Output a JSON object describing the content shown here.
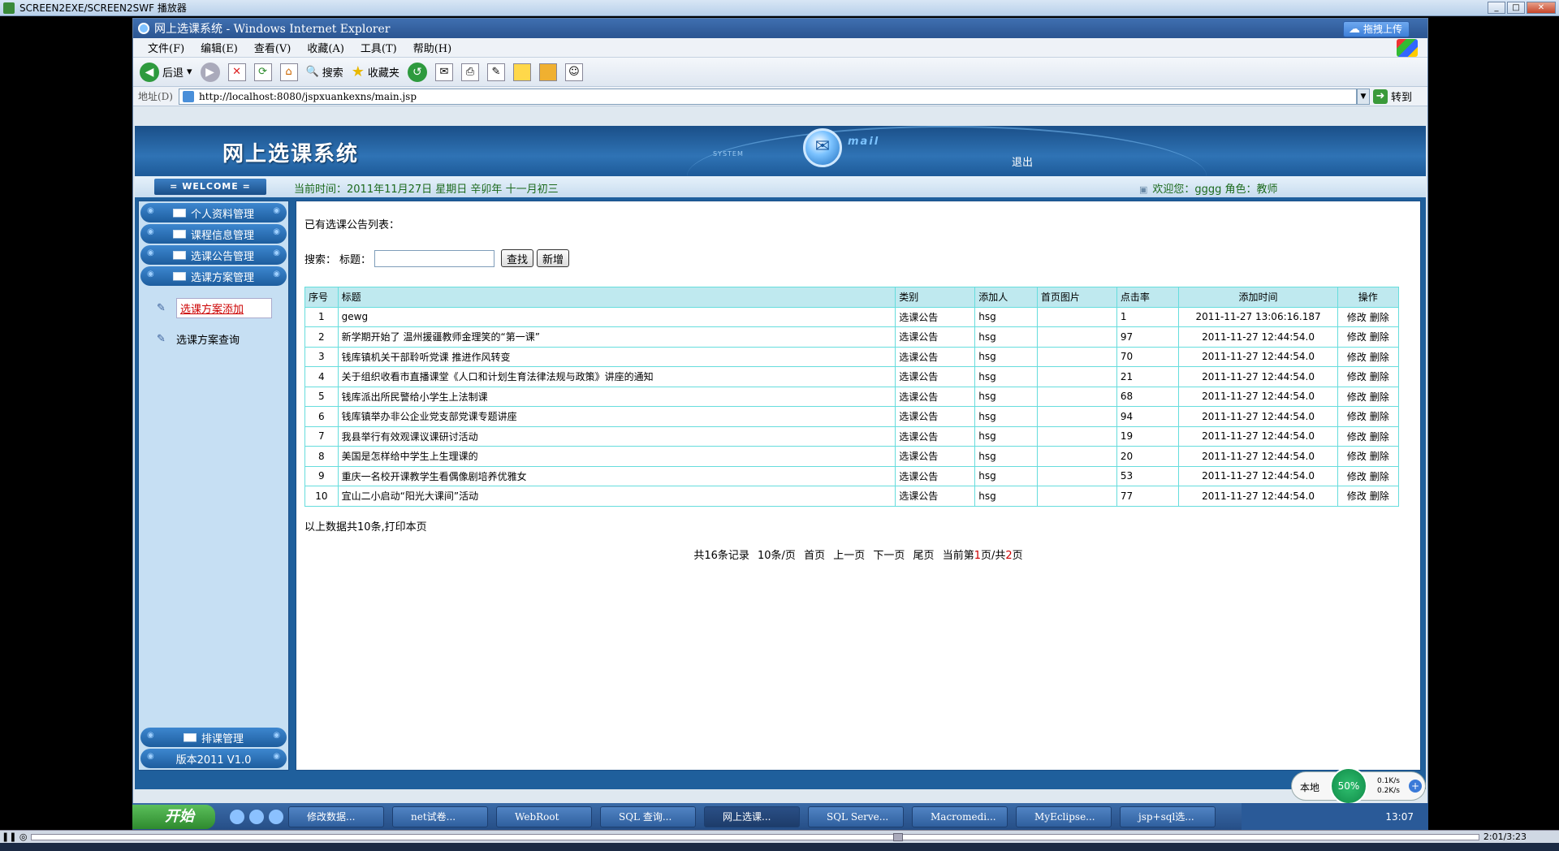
{
  "player": {
    "title": "SCREEN2EXE/SCREEN2SWF 播放器",
    "time": "2:01/3:23"
  },
  "ie": {
    "title": "网上选课系统 - Windows Internet Explorer",
    "baidu_btn": "拖拽上传",
    "menus": [
      "文件(F)",
      "编辑(E)",
      "查看(V)",
      "收藏(A)",
      "工具(T)",
      "帮助(H)"
    ],
    "toolbar": {
      "back": "后退",
      "search": "搜索",
      "favorites": "收藏夹"
    },
    "address_label": "地址(D)",
    "url": "http://localhost:8080/jspxuankexns/main.jsp",
    "go": "转到"
  },
  "header": {
    "system_title": "网上选课系统",
    "system_tag": "SYSTEM",
    "mail_text": "mail",
    "logout": "退出",
    "welcome": "= WELCOME =",
    "current_time": "当前时间：2011年11月27日 星期日 辛卯年 十一月初三",
    "user_info": "欢迎您：gggg 角色：教师"
  },
  "nav": {
    "items": [
      "个人资料管理",
      "课程信息管理",
      "选课公告管理",
      "选课方案管理"
    ],
    "sub_items": [
      "选课方案添加",
      "选课方案查询"
    ],
    "bottom_items": [
      "排课管理",
      "版本2011 V1.0"
    ]
  },
  "main": {
    "heading": "已有选课公告列表：",
    "search_label": "搜索：",
    "title_label": "标题：",
    "search_value": "",
    "search_btn": "查找",
    "add_btn": "新增",
    "columns": [
      "序号",
      "标题",
      "类别",
      "添加人",
      "首页图片",
      "点击率",
      "添加时间",
      "操作"
    ],
    "rows": [
      {
        "no": "1",
        "title": "gewg",
        "category": "选课公告",
        "author": "hsg",
        "image": "",
        "clicks": "1",
        "time": "2011-11-27 13:06:16.187"
      },
      {
        "no": "2",
        "title": "新学期开始了 温州援疆教师金理笑的“第一课”",
        "category": "选课公告",
        "author": "hsg",
        "image": "",
        "clicks": "97",
        "time": "2011-11-27 12:44:54.0"
      },
      {
        "no": "3",
        "title": "钱库镇机关干部聆听党课 推进作风转变",
        "category": "选课公告",
        "author": "hsg",
        "image": "",
        "clicks": "70",
        "time": "2011-11-27 12:44:54.0"
      },
      {
        "no": "4",
        "title": "关于组织收看市直播课堂《人口和计划生育法律法规与政策》讲座的通知",
        "category": "选课公告",
        "author": "hsg",
        "image": "",
        "clicks": "21",
        "time": "2011-11-27 12:44:54.0"
      },
      {
        "no": "5",
        "title": "钱库派出所民警给小学生上法制课",
        "category": "选课公告",
        "author": "hsg",
        "image": "",
        "clicks": "68",
        "time": "2011-11-27 12:44:54.0"
      },
      {
        "no": "6",
        "title": "钱库镇举办非公企业党支部党课专题讲座",
        "category": "选课公告",
        "author": "hsg",
        "image": "",
        "clicks": "94",
        "time": "2011-11-27 12:44:54.0"
      },
      {
        "no": "7",
        "title": "我县举行有效观课议课研讨活动",
        "category": "选课公告",
        "author": "hsg",
        "image": "",
        "clicks": "19",
        "time": "2011-11-27 12:44:54.0"
      },
      {
        "no": "8",
        "title": "美国是怎样给中学生上生理课的",
        "category": "选课公告",
        "author": "hsg",
        "image": "",
        "clicks": "20",
        "time": "2011-11-27 12:44:54.0"
      },
      {
        "no": "9",
        "title": "重庆一名校开课教学生看偶像剧培养优雅女",
        "category": "选课公告",
        "author": "hsg",
        "image": "",
        "clicks": "53",
        "time": "2011-11-27 12:44:54.0"
      },
      {
        "no": "10",
        "title": "宜山二小启动“阳光大课间”活动",
        "category": "选课公告",
        "author": "hsg",
        "image": "",
        "clicks": "77",
        "time": "2011-11-27 12:44:54.0"
      }
    ],
    "edit_label": "修改",
    "delete_label": "删除",
    "summary": "以上数据共10条,打印本页",
    "pager": {
      "total": "共16条记录",
      "per_page": "10条/页",
      "first": "首页",
      "prev": "上一页",
      "next": "下一页",
      "last": "尾页",
      "current_pre": "当前第",
      "current_page": "1",
      "current_mid": "页/共",
      "total_pages": "2",
      "current_post": "页"
    }
  },
  "net": {
    "label": "本地",
    "percent": "50%",
    "up": "0.1K/s",
    "down": "0.2K/s"
  },
  "taskbar": {
    "start": "开始",
    "tasks": [
      "修改数据...",
      "net试卷...",
      "WebRoot",
      "SQL 查询...",
      "网上选课...",
      "SQL Serve...",
      "Macromedi...",
      "MyEclipse...",
      "jsp+sql选..."
    ],
    "clock": "13:07"
  }
}
